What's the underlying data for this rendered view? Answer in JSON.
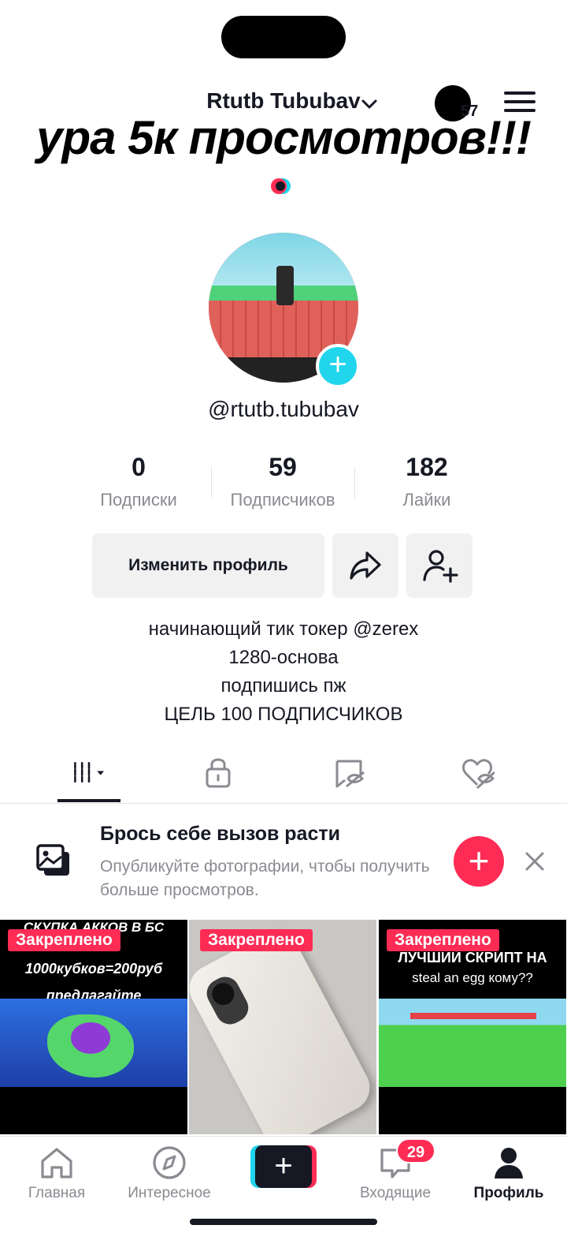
{
  "status": {
    "island": ""
  },
  "header": {
    "username": "Rtutb Tububav",
    "views_count": "57"
  },
  "overlay": {
    "caption": "ура 5к просмотров!!!"
  },
  "profile": {
    "handle": "@rtutb.tububav",
    "stats": [
      {
        "value": "0",
        "label": "Подписки"
      },
      {
        "value": "59",
        "label": "Подписчиков"
      },
      {
        "value": "182",
        "label": "Лайки"
      }
    ],
    "edit_label": "Изменить профиль",
    "bio": [
      "начинающий тик токер @zerex",
      "1280-основа",
      "подпишись пж",
      "ЦЕЛЬ 100 ПОДПИСЧИКОВ"
    ]
  },
  "promo": {
    "title": "Брось себе вызов расти",
    "subtitle": "Опубликуйте фотографии, чтобы получить больше просмотров."
  },
  "videos": [
    {
      "badge": "Закреплено",
      "lines": [
        "СКУПКА АККОВ В БС",
        "1000кубков=200руб",
        "предлагайте"
      ]
    },
    {
      "badge": "Закреплено",
      "lines": []
    },
    {
      "badge": "Закреплено",
      "lines": [
        "ЛУЧШИЙ СКРИПТ НА",
        "steal an egg кому??"
      ]
    }
  ],
  "nav": {
    "home": "Главная",
    "discover": "Интересное",
    "inbox": "Входящие",
    "inbox_badge": "29",
    "profile": "Профиль"
  },
  "colors": {
    "accent_pink": "#fe2c55",
    "accent_cyan": "#20d5ec",
    "text": "#161823",
    "muted": "#8a8b91"
  },
  "icons": [
    "chevron-down-icon",
    "menu-icon",
    "share-icon",
    "add-user-icon",
    "grid-icon",
    "lock-icon",
    "tagged-icon",
    "liked-icon",
    "photos-icon",
    "close-icon",
    "home-icon",
    "compass-icon",
    "inbox-icon",
    "profile-icon"
  ]
}
